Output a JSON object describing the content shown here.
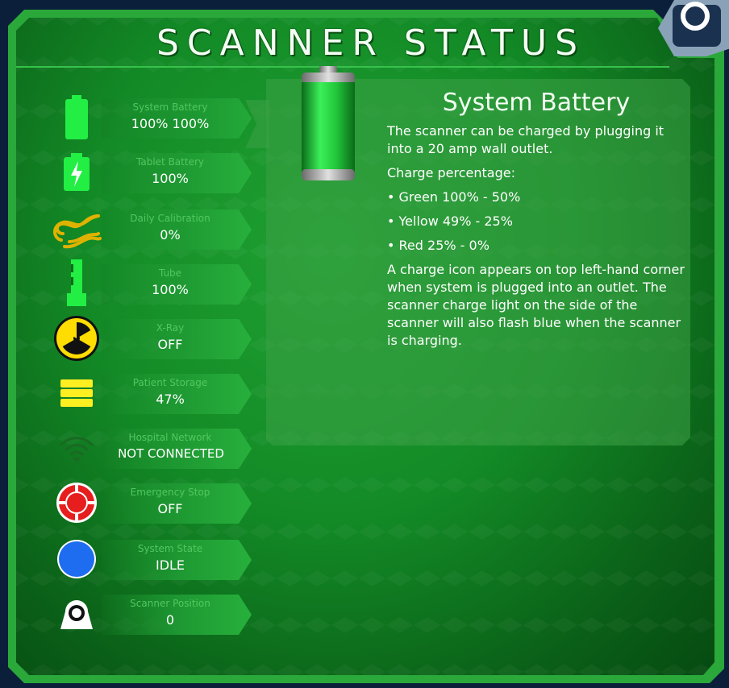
{
  "header": {
    "title": "SCANNER STATUS"
  },
  "status_items": [
    {
      "label": "System Battery",
      "value": "100% 100%",
      "icon": "battery-icon",
      "color": "#22ee44"
    },
    {
      "label": "Tablet Battery",
      "value": "100%",
      "icon": "charging-battery-icon",
      "color": "#22ee44"
    },
    {
      "label": "Daily Calibration",
      "value": "0%",
      "icon": "calibration-wave-icon",
      "color": "#e0b200"
    },
    {
      "label": "Tube",
      "value": "100%",
      "icon": "tube-icon",
      "color": "#22ee44"
    },
    {
      "label": "X-Ray",
      "value": "OFF",
      "icon": "radiation-icon",
      "color": "#ffdd00"
    },
    {
      "label": "Patient Storage",
      "value": "47%",
      "icon": "storage-icon",
      "color": "#ffee22"
    },
    {
      "label": "Hospital Network",
      "value": "NOT CONNECTED",
      "icon": "wifi-icon",
      "color": "#1a6a22"
    },
    {
      "label": "Emergency Stop",
      "value": "OFF",
      "icon": "emergency-stop-icon",
      "color": "#e61e1e"
    },
    {
      "label": "System State",
      "value": "IDLE",
      "icon": "system-state-icon",
      "color": "#1e6cf0"
    },
    {
      "label": "Scanner Position",
      "value": "0",
      "icon": "scanner-position-icon",
      "color": "#ffffff"
    }
  ],
  "detail": {
    "title": "System Battery",
    "intro": "The scanner can be charged by plugging it into a 20 amp wall outlet.",
    "charge_heading": "Charge percentage:",
    "charge_levels": [
      "• Green 100% - 50%",
      "• Yellow 49% - 25%",
      "• Red 25% - 0%"
    ],
    "note": "A charge icon appears on top left-hand corner when system is plugged into an outlet. The scanner charge light on the side of the scanner will also flash blue when the scanner is charging."
  },
  "colors": {
    "frame": "#2aa83a",
    "panel": "#138a26",
    "label": "#52c761",
    "value": "#ffffff"
  }
}
